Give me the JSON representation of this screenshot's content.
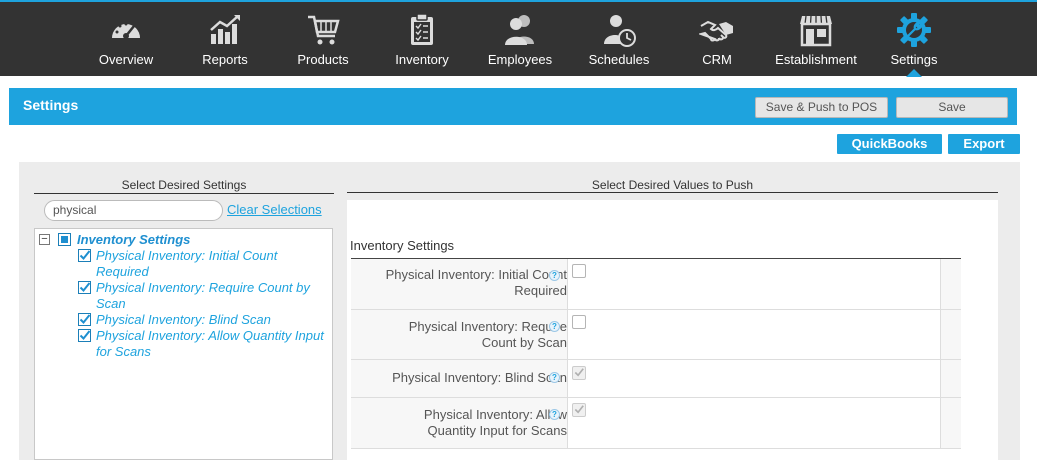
{
  "nav": {
    "items": [
      {
        "label": "Overview",
        "icon": "speedometer-icon"
      },
      {
        "label": "Reports",
        "icon": "bar-chart-icon"
      },
      {
        "label": "Products",
        "icon": "shopping-cart-icon"
      },
      {
        "label": "Inventory",
        "icon": "clipboard-icon"
      },
      {
        "label": "Employees",
        "icon": "people-icon"
      },
      {
        "label": "Schedules",
        "icon": "person-clock-icon"
      },
      {
        "label": "CRM",
        "icon": "handshake-icon"
      },
      {
        "label": "Establishment",
        "icon": "storefront-icon"
      },
      {
        "label": "Settings",
        "icon": "gear-wrench-icon",
        "active": true
      }
    ]
  },
  "header": {
    "title": "Settings",
    "save_push_label": "Save & Push to POS",
    "save_label": "Save"
  },
  "actions": {
    "quickbooks_label": "QuickBooks",
    "export_label": "Export"
  },
  "left": {
    "title": "Select Desired Settings",
    "search_value": "physical",
    "clear_label": "Clear Selections",
    "tree": {
      "root_label": "Inventory Settings",
      "root_state": "partial",
      "children": [
        {
          "label_line1": "Physical Inventory: Initial Count",
          "label_line2": "Required",
          "checked": true
        },
        {
          "label_line1": "Physical Inventory: Require Count by",
          "label_line2": "Scan",
          "checked": true
        },
        {
          "label_line1": "Physical Inventory: Blind Scan",
          "label_line2": "",
          "checked": true
        },
        {
          "label_line1": "Physical Inventory: Allow Quantity Input",
          "label_line2": "for Scans",
          "checked": true
        }
      ]
    }
  },
  "right": {
    "title": "Select Desired Values to Push",
    "section_title": "Inventory Settings",
    "rows": [
      {
        "label_line1": "Physical Inventory: Initial Count",
        "label_line2": "Required",
        "checked": false,
        "disabled": false
      },
      {
        "label_line1": "Physical Inventory: Require",
        "label_line2": "Count by Scan",
        "checked": false,
        "disabled": false
      },
      {
        "label_line1": "Physical Inventory: Blind Scan",
        "label_line2": "",
        "checked": true,
        "disabled": true
      },
      {
        "label_line1": "Physical Inventory: Allow",
        "label_line2": "Quantity Input for Scans",
        "checked": true,
        "disabled": true
      }
    ],
    "help_glyph": "?"
  },
  "colors": {
    "accent": "#1ea3de",
    "topbar": "#333333",
    "panel": "#ececec"
  }
}
